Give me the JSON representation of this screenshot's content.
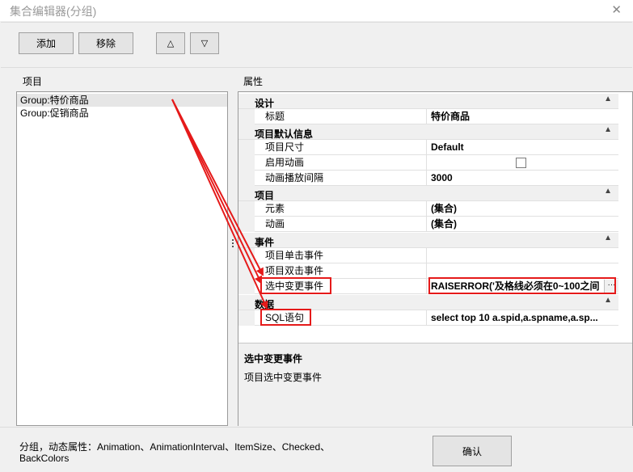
{
  "window": {
    "title": "集合编辑器(分组)",
    "close_glyph": "✕"
  },
  "toolbar": {
    "add_label": "添加",
    "remove_label": "移除",
    "up_glyph": "△",
    "down_glyph": "▽"
  },
  "items_panel": {
    "label": "项目",
    "items": [
      {
        "text": "Group:特价商品",
        "selected": true
      },
      {
        "text": "Group:促销商品",
        "selected": false
      }
    ]
  },
  "props_panel": {
    "label": "属性",
    "categories": [
      {
        "name": "设计",
        "collapse_glyph": "▲",
        "props": [
          {
            "name": "标题",
            "value": "特价商品"
          }
        ]
      },
      {
        "name": "项目默认信息",
        "collapse_glyph": "▲",
        "props": [
          {
            "name": "项目尺寸",
            "value": "Default"
          },
          {
            "name": "启用动画",
            "value": "",
            "checkbox": true,
            "checked": false
          },
          {
            "name": "动画播放间隔",
            "value": "3000"
          }
        ]
      },
      {
        "name": "项目",
        "collapse_glyph": "▲",
        "props": [
          {
            "name": "元素",
            "value": "(集合)"
          },
          {
            "name": "动画",
            "value": "(集合)"
          }
        ]
      },
      {
        "name": "事件",
        "collapse_glyph": "▲",
        "props": [
          {
            "name": "项目单击事件",
            "value": ""
          },
          {
            "name": "项目双击事件",
            "value": ""
          },
          {
            "name": "选中变更事件",
            "value": "RAISERROR('及格线必须在0~100之间",
            "ellipsis": "···"
          }
        ]
      },
      {
        "name": "数据",
        "collapse_glyph": "▲",
        "props": [
          {
            "name": "SQL语句",
            "value": "select top 10 a.spid,a.spname,a.sp..."
          }
        ]
      }
    ],
    "description": {
      "title": "选中变更事件",
      "text": "项目选中变更事件"
    }
  },
  "footer": {
    "info_text": "分组，动态属性：Animation、AnimationInterval、ItemSize、Checked、BackColors",
    "ok_label": "确认"
  },
  "colors": {
    "annotation_red": "#e51a1a",
    "window_bg": "#f0f0f0"
  }
}
